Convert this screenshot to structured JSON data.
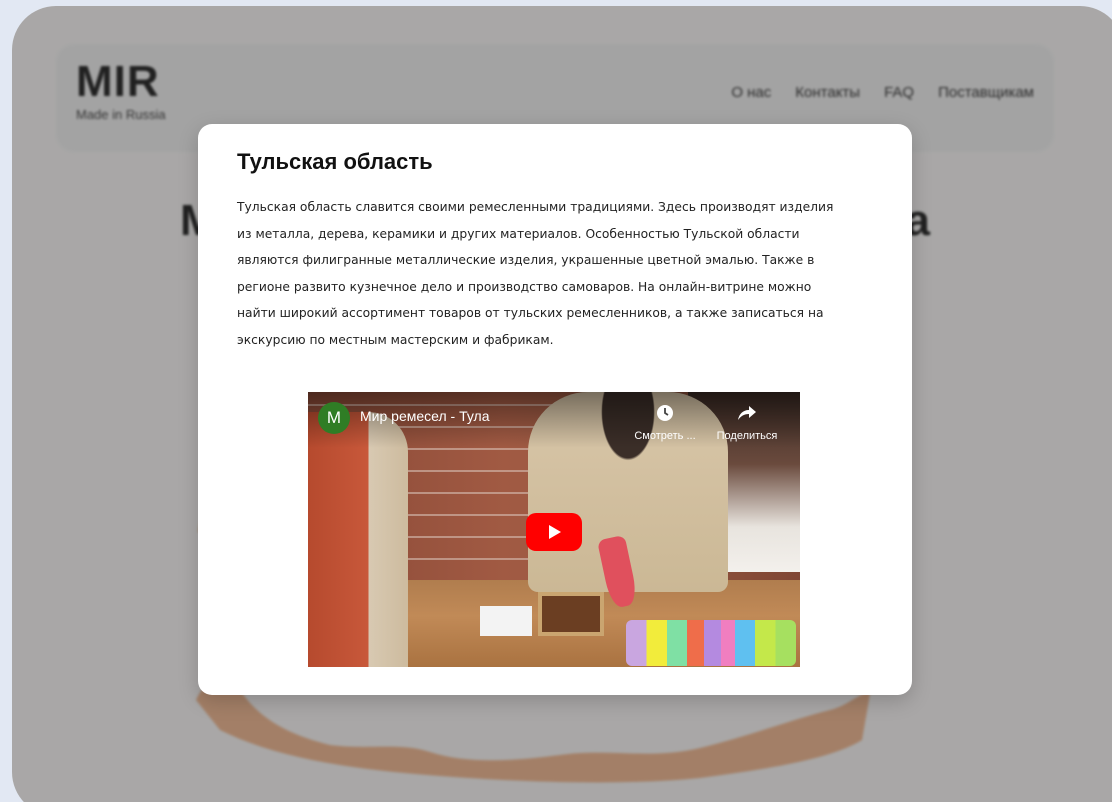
{
  "site": {
    "logo": "MIR",
    "tagline": "Made in Russia",
    "nav": [
      "О нас",
      "Контакты",
      "FAQ",
      "Поставщикам"
    ],
    "hero_left": "M",
    "hero_right": "a"
  },
  "modal": {
    "title": "Тульская область",
    "text": "Тульская область славится своими ремесленными традициями. Здесь производят изделия из металла, дерева, керамики и других материалов. Особенностью Тульской области являются филигранные металлические изделия, украшенные цветной эмалью. Также в регионе развито кузнечное дело и производство самоваров. На онлайн-витрине можно найти широкий ассортимент товаров от тульских ремесленников, а также записаться на экскурсию по местным мастерским и фабрикам."
  },
  "video": {
    "avatar_letter": "M",
    "title": "Мир ремесел - Тула",
    "watch_label": "Смотреть ...",
    "share_label": "Поделиться",
    "watch_icon": "clock-icon",
    "share_icon": "share-arrow-icon",
    "play_icon": "play-icon"
  },
  "colors": {
    "overlay": "#5a5a5a",
    "map_fill": "#f2b48a",
    "youtube_red": "#ff0000",
    "channel_avatar": "#2f7d25"
  }
}
